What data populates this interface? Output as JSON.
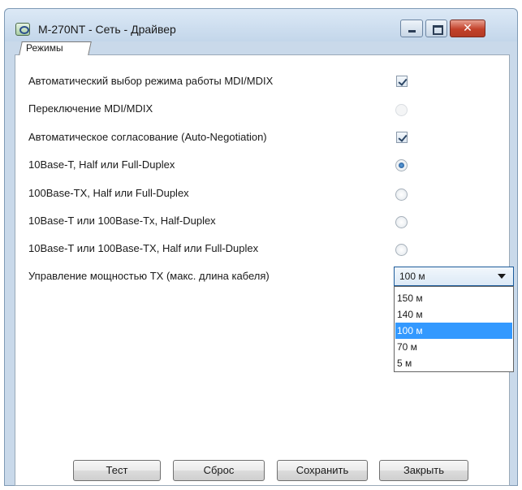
{
  "window": {
    "title": "M-270NT - Сеть - Драйвер"
  },
  "tabs": [
    {
      "label": "Режимы"
    }
  ],
  "settings": [
    {
      "label": "Автоматический выбор режима работы MDI/MDIX",
      "control": "checkbox",
      "checked": true,
      "enabled": true
    },
    {
      "label": "Переключение MDI/MDIX",
      "control": "radio",
      "checked": false,
      "enabled": false
    },
    {
      "label": "Автоматическое согласование (Auto-Negotiation)",
      "control": "checkbox",
      "checked": true,
      "enabled": true
    },
    {
      "label": "10Base-T, Half или Full-Duplex",
      "control": "radio",
      "checked": true,
      "enabled": true
    },
    {
      "label": "100Base-TX, Half или Full-Duplex",
      "control": "radio",
      "checked": false,
      "enabled": true
    },
    {
      "label": "10Base-T или 100Base-Tx, Half-Duplex",
      "control": "radio",
      "checked": false,
      "enabled": true
    },
    {
      "label": "10Base-T или 100Base-TX, Half или Full-Duplex",
      "control": "radio",
      "checked": false,
      "enabled": true
    },
    {
      "label": "Управление мощностью TX (макс. длина кабеля)",
      "control": "select"
    }
  ],
  "tx_power": {
    "value": "100 м",
    "options": [
      "150 м",
      "140 м",
      "100 м",
      "70 м",
      "5 м"
    ],
    "highlighted": "100 м"
  },
  "buttons": {
    "test": "Тест",
    "reset": "Сброс",
    "save": "Сохранить",
    "close": "Закрыть"
  },
  "colors": {
    "selection": "#3399ff",
    "window_frame": "#c9d9ea",
    "close_button": "#c2412a"
  }
}
